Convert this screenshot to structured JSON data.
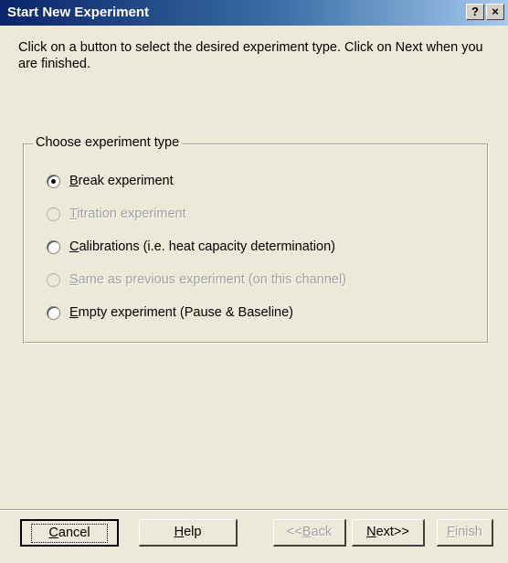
{
  "window": {
    "title": "Start New Experiment",
    "help_button": "?",
    "close_button": "×"
  },
  "instructions": "Click on a button to select the desired experiment type. Click on Next when you are finished.",
  "group": {
    "title": "Choose experiment type",
    "options": [
      {
        "ul": "B",
        "rest": "reak experiment",
        "checked": true,
        "enabled": true
      },
      {
        "ul": "T",
        "rest": "itration experiment",
        "checked": false,
        "enabled": false
      },
      {
        "ul": "C",
        "rest": "alibrations (i.e. heat capacity determination)",
        "checked": false,
        "enabled": true
      },
      {
        "ul": "S",
        "rest": "ame as previous experiment (on this channel)",
        "checked": false,
        "enabled": false
      },
      {
        "ul": "E",
        "rest": "mpty experiment (Pause & Baseline)",
        "checked": false,
        "enabled": true
      }
    ]
  },
  "buttons": {
    "cancel": {
      "ul": "C",
      "rest": "ancel",
      "enabled": true
    },
    "help": {
      "ul": "H",
      "rest": "elp",
      "enabled": true
    },
    "back": {
      "pre": "<<",
      "ul": "B",
      "rest": "ack",
      "enabled": false
    },
    "next": {
      "ul": "N",
      "rest": "ext>>",
      "enabled": true
    },
    "finish": {
      "ul": "F",
      "rest": "inish",
      "enabled": false
    }
  }
}
